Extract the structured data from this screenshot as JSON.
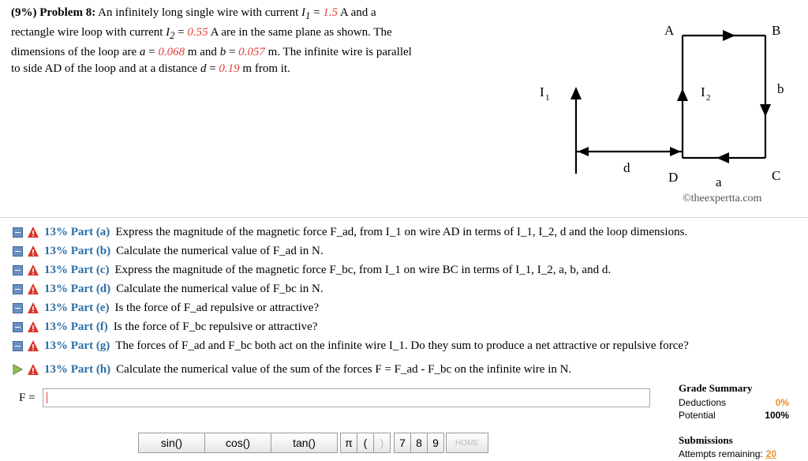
{
  "problem": {
    "label": "(9%) Problem 8:",
    "line1a": " An infinitely long single wire with current ",
    "i1": "I",
    "i1sub": "1",
    "eq": " = ",
    "i1val": "1.5",
    "line1b": " A and a",
    "line2a": "rectangle wire loop with current ",
    "i2": "I",
    "i2sub": "2",
    "i2val": "0.55",
    "line2b": " A are in the same plane as shown. The",
    "line3a": "dimensions of the loop are ",
    "a_var": "a",
    "a_val": "0.068",
    "line3b": " m and ",
    "b_var": "b",
    "b_val": "0.057",
    "line3c": " m. The infinite wire is parallel",
    "line4a": "to side AD of the loop and at a distance ",
    "d_var": "d",
    "d_val": "0.19",
    "line4b": " m from it."
  },
  "diagram": {
    "A": "A",
    "B": "B",
    "C": "C",
    "D": "D",
    "I1": "I",
    "I1sub": "1",
    "I2": "I",
    "I2sub": "2",
    "a": "a",
    "b": "b",
    "d": "d",
    "watermark": "©theexpertta.com"
  },
  "parts": [
    {
      "label": "13% Part (a)",
      "text": "Express the magnitude of the magnetic force F_ad, from I_1 on wire AD in terms of I_1, I_2, d and the loop dimensions."
    },
    {
      "label": "13% Part (b)",
      "text": "Calculate the numerical value of F_ad in N."
    },
    {
      "label": "13% Part (c)",
      "text": "Express the magnitude of the magnetic force F_bc, from I_1 on wire BC in terms of I_1, I_2, a, b, and d."
    },
    {
      "label": "13% Part (d)",
      "text": "Calculate the numerical value of F_bc in N."
    },
    {
      "label": "13% Part (e)",
      "text": "Is the force of F_ad repulsive or attractive?"
    },
    {
      "label": "13% Part (f)",
      "text": "Is the force of F_bc repulsive or attractive?"
    },
    {
      "label": "13% Part (g)",
      "text": "The forces of F_ad and F_bc both act on the infinite wire I_1. Do they sum to produce a net attractive or repulsive force?"
    },
    {
      "label": "13% Part (h)",
      "text": "Calculate the numerical value of the sum of the forces F = F_ad - F_bc on the infinite wire in N."
    }
  ],
  "answer": {
    "label": "F = ",
    "value": ""
  },
  "grade": {
    "title": "Grade Summary",
    "deductions_label": "Deductions",
    "deductions_value": "0%",
    "potential_label": "Potential",
    "potential_value": "100%"
  },
  "submissions": {
    "title": "Submissions",
    "attempts_label": "Attempts remaining:",
    "attempts_value": "20"
  },
  "keypad": {
    "sin": "sin()",
    "cos": "cos()",
    "tan": "tan()",
    "pi": "π",
    "lparen": "(",
    "rparen": ")",
    "k7": "7",
    "k8": "8",
    "k9": "9",
    "home": "HOME"
  },
  "colors": {
    "accent_blue": "#2b6ea6",
    "given_red": "#e2403a",
    "grade_orange": "#e8912b"
  }
}
